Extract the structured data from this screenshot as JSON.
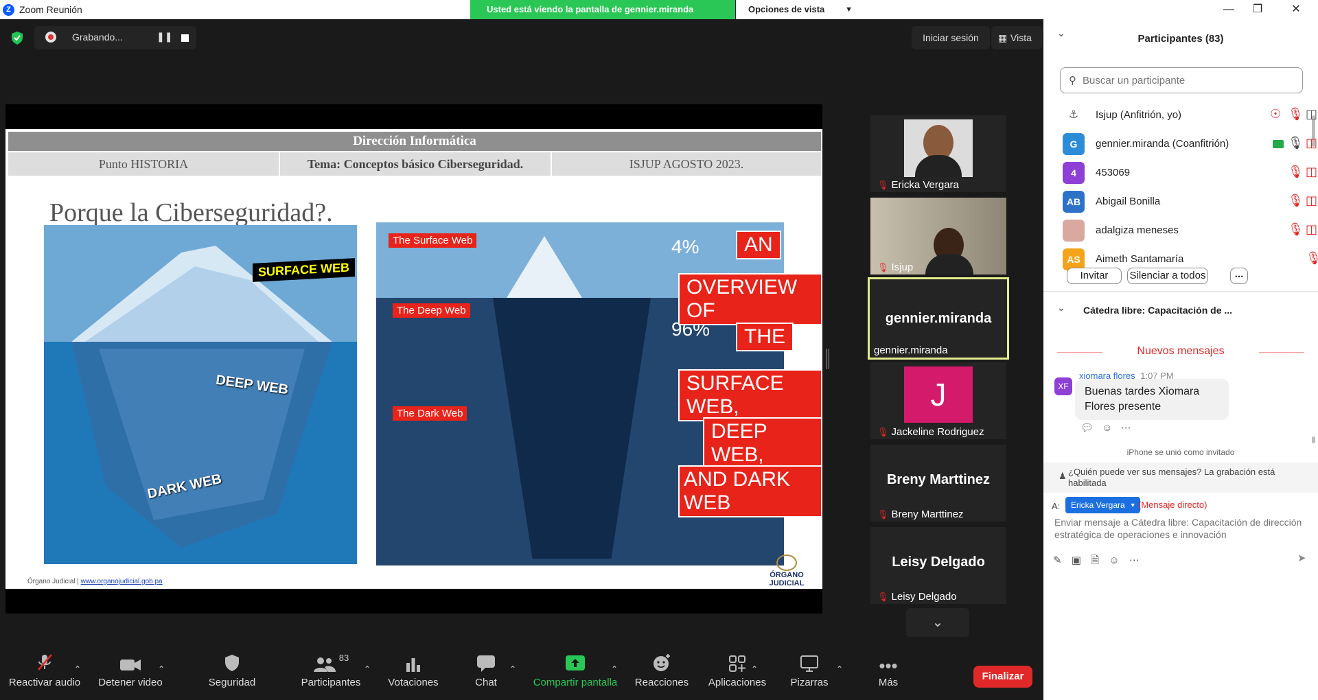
{
  "window": {
    "title": "Zoom Reunión"
  },
  "share_banner": {
    "text": "Usted está viendo la pantalla de gennier.miranda",
    "view_options": "Opciones de vista"
  },
  "recording": {
    "label": "Grabando..."
  },
  "top_right": {
    "signin": "Iniciar sesión",
    "view": "Vista"
  },
  "slide": {
    "header": "Dirección Informática",
    "cols": [
      "Punto HISTORIA",
      "Tema: Conceptos básico Ciberseguridad.",
      "ISJUP AGOSTO 2023."
    ],
    "heading": "Porque la Ciberseguridad?.",
    "iceberg_labels": {
      "surface": "SURFACE WEB",
      "deep": "DEEP WEB",
      "dark": "DARK WEB"
    },
    "info_titles": {
      "surface": "The Surface Web",
      "deep": "The Deep Web",
      "dark": "The Dark Web"
    },
    "stats": {
      "p4": "4%",
      "p96": "96%"
    },
    "overview": [
      "AN",
      "OVERVIEW OF",
      "THE",
      "SURFACE WEB,",
      "DEEP WEB,",
      "AND DARK WEB"
    ],
    "footer_left": "Órgano Judicial |",
    "footer_link": "www.organojudicial.gob.pa",
    "logo_text": "ÓRGANO JUDICIAL"
  },
  "tiles": [
    {
      "name": "Ericka Vergara",
      "muted": true
    },
    {
      "name": "Isjup",
      "muted": true
    },
    {
      "name": "gennier.miranda",
      "big": "gennier.miranda",
      "muted": false
    },
    {
      "name": "Jackeline Rodriguez",
      "initial": "J",
      "muted": true
    },
    {
      "name": "Breny Marttinez",
      "big": "Breny Marttinez",
      "muted": true
    },
    {
      "name": "Leisy Delgado",
      "big": "Leisy Delgado",
      "muted": true
    }
  ],
  "toolbar": {
    "audio": "Reactivar audio",
    "video": "Detener video",
    "security": "Seguridad",
    "participants": "Participantes",
    "participants_count": "83",
    "polls": "Votaciones",
    "chat": "Chat",
    "share": "Compartir pantalla",
    "reactions": "Reacciones",
    "apps": "Aplicaciones",
    "whiteboards": "Pizarras",
    "more": "Más",
    "end": "Finalizar"
  },
  "participants_panel": {
    "title": "Participantes (83)",
    "search_placeholder": "Buscar un participante",
    "rows": [
      {
        "name": "Isjup (Anfitrión, yo)",
        "initials": "",
        "color": "#ffffff"
      },
      {
        "name": "gennier.miranda (Coanfitrión)",
        "initials": "G",
        "color": "#2d8cd8"
      },
      {
        "name": "453069",
        "initials": "4",
        "color": "#8e3fd6"
      },
      {
        "name": "Abigail Bonilla",
        "initials": "AB",
        "color": "#2d72c8"
      },
      {
        "name": "adalgiza meneses",
        "initials": "",
        "color": "#d9a9a0"
      },
      {
        "name": "Aimeth Santamaría",
        "initials": "AS",
        "color": "#f5a31a"
      }
    ],
    "invite": "Invitar",
    "mute_all": "Silenciar a todos",
    "more": "..."
  },
  "chat_panel": {
    "title": "Cátedra libre: Capacitación de ...",
    "new_messages": "Nuevos mensajes",
    "message": {
      "initials": "XF",
      "sender": "xiomara flores",
      "time": "1:07 PM",
      "text": "Buenas tardes Xiomara Flores presente"
    },
    "system": "iPhone se unió como invitado",
    "notice": "¿Quién puede ver sus mensajes? La grabación está habilitada",
    "to_label": "A:",
    "recipient": "Ericka Vergara",
    "direct": "(Mensaje directo)",
    "input_placeholder": "Enviar mensaje a Cátedra libre: Capacitación de dirección estratégica de operaciones e innovación"
  },
  "colors": {
    "accent": "#0b5cff",
    "green": "#2ac756",
    "end": "#e02828",
    "slide_red": "#e8231a"
  }
}
